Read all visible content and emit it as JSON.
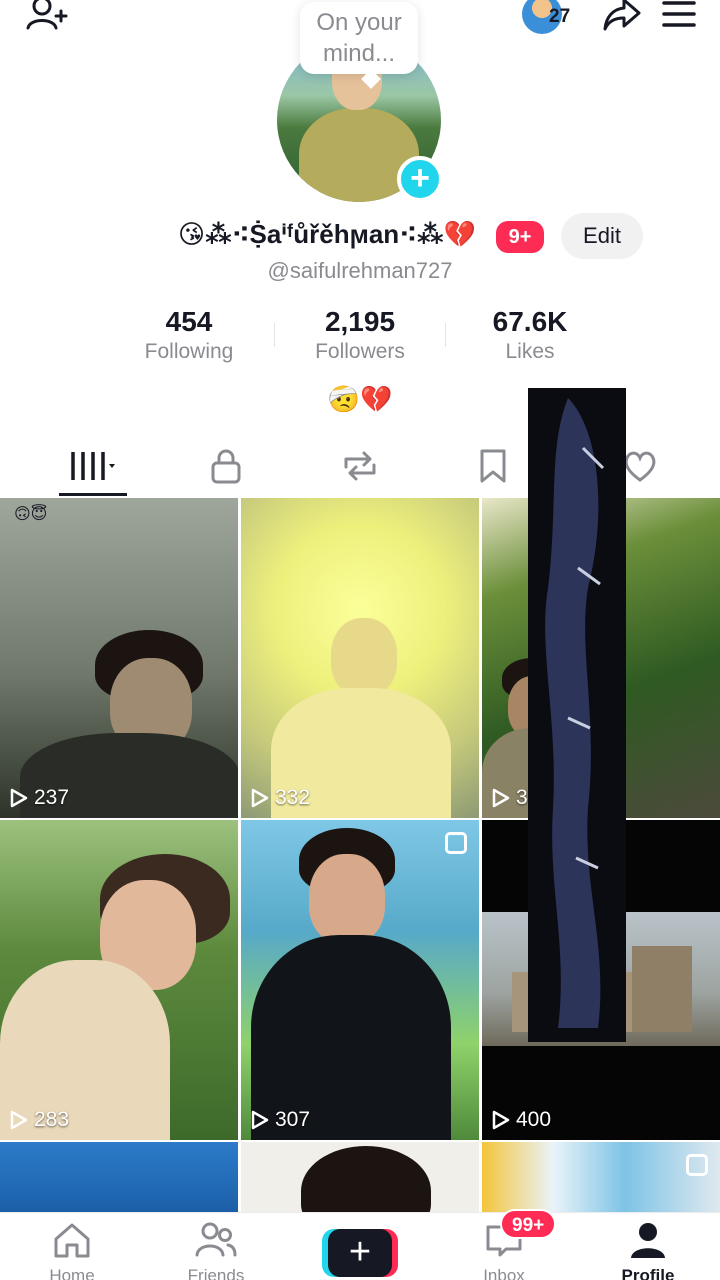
{
  "header": {
    "thought_bubble": "On your mind...",
    "mini_avatar_count": "27"
  },
  "profile": {
    "display_name": "😘⁂⁖Ṩaⁱᶠůřěhϻan⁖⁂💔",
    "badge": "9+",
    "edit_label": "Edit",
    "handle": "@saifulrehman727",
    "bio": "🤕💔"
  },
  "stats": [
    {
      "value": "454",
      "label": "Following"
    },
    {
      "value": "2,195",
      "label": "Followers"
    },
    {
      "value": "67.6K",
      "label": "Likes"
    }
  ],
  "tabs": [
    "videos",
    "private",
    "reposts",
    "favorites",
    "liked"
  ],
  "videos": [
    {
      "views": "237",
      "sticker": "🙃😇"
    },
    {
      "views": "332"
    },
    {
      "views": "330"
    },
    {
      "views": "283"
    },
    {
      "views": "307"
    },
    {
      "views": "400"
    }
  ],
  "bottom_nav": {
    "home": "Home",
    "friends": "Friends",
    "inbox": "Inbox",
    "inbox_badge": "99+",
    "profile": "Profile"
  },
  "colors": {
    "accent_red": "#fe2c55",
    "accent_cyan": "#20d5ec",
    "text_primary": "#161823",
    "text_secondary": "#8a8b91"
  }
}
